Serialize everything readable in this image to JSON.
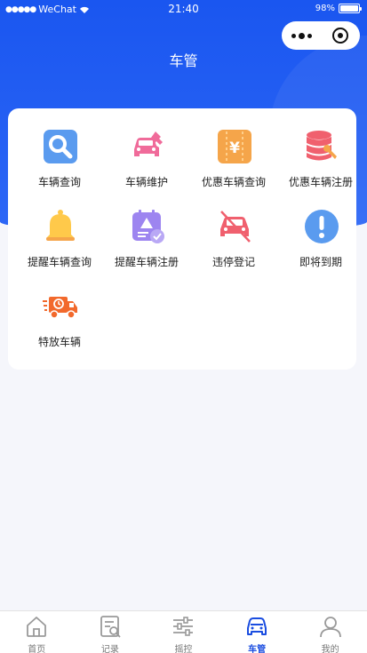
{
  "status_bar": {
    "carrier": "WeChat",
    "time": "21:40",
    "battery": "98%",
    "battery_level": 0.98
  },
  "header": {
    "title": "车管"
  },
  "colors": {
    "primary": "#1a56f0",
    "tab_active": "#1a4de0",
    "tab_inactive": "#9a9a9a"
  },
  "grid": {
    "items": [
      {
        "label": "车辆查询",
        "icon": "vehicle-search-icon"
      },
      {
        "label": "车辆维护",
        "icon": "vehicle-maintenance-icon"
      },
      {
        "label": "优惠车辆查询",
        "icon": "discount-ticket-icon"
      },
      {
        "label": "优惠车辆注册",
        "icon": "database-settings-icon"
      },
      {
        "label": "提醒车辆查询",
        "icon": "bell-icon"
      },
      {
        "label": "提醒车辆注册",
        "icon": "calendar-warning-icon"
      },
      {
        "label": "违停登记",
        "icon": "no-parking-car-icon"
      },
      {
        "label": "即将到期",
        "icon": "exclamation-icon"
      },
      {
        "label": "特放车辆",
        "icon": "delivery-truck-icon"
      }
    ]
  },
  "tabbar": {
    "tabs": [
      {
        "label": "首页",
        "icon": "home-icon"
      },
      {
        "label": "记录",
        "icon": "record-icon"
      },
      {
        "label": "摇控",
        "icon": "sliders-icon"
      },
      {
        "label": "车管",
        "icon": "car-icon",
        "active": true
      },
      {
        "label": "我的",
        "icon": "user-icon"
      }
    ]
  }
}
